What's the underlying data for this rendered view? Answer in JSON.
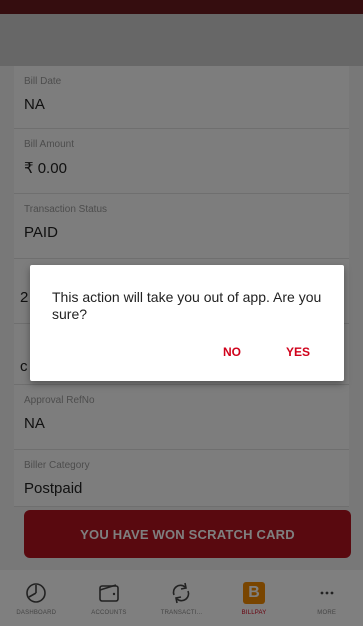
{
  "fields": [
    {
      "label": "Bill Date",
      "value": "NA"
    },
    {
      "label": "Bill Amount",
      "value": "₹ 0.00"
    },
    {
      "label": "Transaction Status",
      "value": "PAID"
    },
    {
      "label": "",
      "value": "2"
    },
    {
      "label": "",
      "value": "c"
    },
    {
      "label": "Approval RefNo",
      "value": "NA"
    },
    {
      "label": "Biller Category",
      "value": "Postpaid"
    }
  ],
  "banner": {
    "label": "YOU HAVE WON SCRATCH CARD"
  },
  "dialog": {
    "message": "This action will take you out of app. Are you sure?",
    "no_label": "NO",
    "yes_label": "YES"
  },
  "bottom_nav": {
    "items": [
      {
        "label": "DASHBOARD",
        "icon": "dashboard-icon"
      },
      {
        "label": "ACCOUNTS",
        "icon": "accounts-icon"
      },
      {
        "label": "TRANSACTI...",
        "icon": "transactions-icon"
      },
      {
        "label": "BILLPAY",
        "icon": "billpay-icon",
        "active": true
      },
      {
        "label": "MORE",
        "icon": "more-icon"
      }
    ]
  },
  "colors": {
    "accent": "#d0021b",
    "banner": "#b3131e",
    "billpay_logo": "#f38b00"
  }
}
